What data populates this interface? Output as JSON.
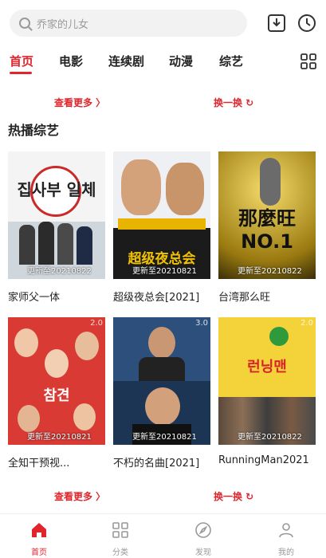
{
  "search": {
    "placeholder": "乔家的儿女"
  },
  "tabs": [
    {
      "label": "首页",
      "active": true
    },
    {
      "label": "电影"
    },
    {
      "label": "连续剧"
    },
    {
      "label": "动漫"
    },
    {
      "label": "综艺"
    }
  ],
  "links": {
    "more": "查看更多 〉",
    "change": "换一换 ↻"
  },
  "section": {
    "title": "热播综艺"
  },
  "cards": [
    {
      "title": "家师父一体",
      "poster_text": "집사부 일체",
      "update": "更新至20210822",
      "score": ""
    },
    {
      "title": "超级夜总会[2021]",
      "poster_text": "超级夜总会",
      "update": "更新至20210821",
      "score": ""
    },
    {
      "title": "台湾那么旺",
      "poster_text": "那麼旺 NO.1",
      "update": "更新至20210822",
      "score": ""
    },
    {
      "title": "全知干预视...",
      "poster_text": "참견",
      "update": "更新至20210821",
      "score": "2.0"
    },
    {
      "title": "不朽的名曲[2021]",
      "poster_text": "",
      "update": "更新至20210821",
      "score": "3.0"
    },
    {
      "title": "RunningMan2021",
      "poster_text": "런닝맨",
      "update": "更新至20210822",
      "score": "2.0"
    }
  ],
  "bottom_nav": [
    {
      "label": "首页",
      "icon": "home-icon",
      "active": true
    },
    {
      "label": "分类",
      "icon": "grid-icon"
    },
    {
      "label": "发现",
      "icon": "compass-icon"
    },
    {
      "label": "我的",
      "icon": "person-icon"
    }
  ],
  "colors": {
    "accent": "#e0252c"
  }
}
